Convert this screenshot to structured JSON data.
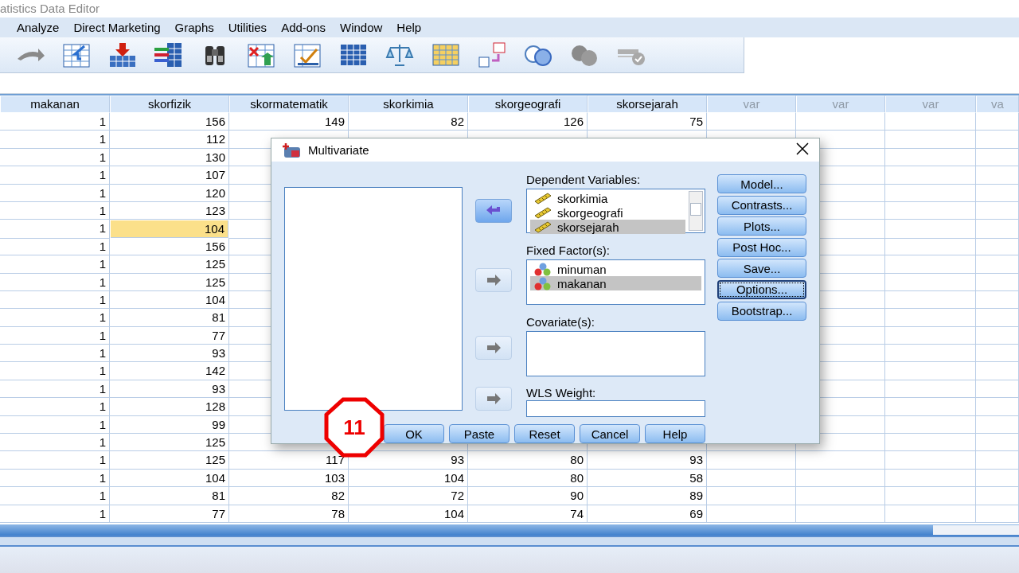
{
  "window": {
    "title": "atistics Data Editor"
  },
  "menu": [
    "Analyze",
    "Direct Marketing",
    "Graphs",
    "Utilities",
    "Add-ons",
    "Window",
    "Help"
  ],
  "grid": {
    "columns": [
      {
        "label": "makanan",
        "kind": "variable"
      },
      {
        "label": "skorfizik",
        "kind": "variable"
      },
      {
        "label": "skormatematik",
        "kind": "variable"
      },
      {
        "label": "skorkimia",
        "kind": "variable"
      },
      {
        "label": "skorgeografi",
        "kind": "variable"
      },
      {
        "label": "skorsejarah",
        "kind": "variable"
      },
      {
        "label": "var",
        "kind": "empty"
      },
      {
        "label": "var",
        "kind": "empty"
      },
      {
        "label": "var",
        "kind": "empty"
      },
      {
        "label": "va",
        "kind": "empty"
      }
    ],
    "rows": [
      {
        "cells": [
          {
            "text": "1",
            "selected": false
          },
          {
            "text": "156",
            "selected": false
          },
          {
            "text": "149",
            "selected": false
          },
          {
            "text": "82",
            "selected": false
          },
          {
            "text": "126",
            "selected": false
          },
          {
            "text": "75",
            "selected": false
          }
        ]
      },
      {
        "cells": [
          {
            "text": "1",
            "selected": false
          },
          {
            "text": "112",
            "selected": false
          }
        ]
      },
      {
        "cells": [
          {
            "text": "1",
            "selected": false
          },
          {
            "text": "130",
            "selected": false
          }
        ]
      },
      {
        "cells": [
          {
            "text": "1",
            "selected": false
          },
          {
            "text": "107",
            "selected": false
          }
        ]
      },
      {
        "cells": [
          {
            "text": "1",
            "selected": false
          },
          {
            "text": "120",
            "selected": false
          }
        ]
      },
      {
        "cells": [
          {
            "text": "1",
            "selected": false
          },
          {
            "text": "123",
            "selected": false
          }
        ]
      },
      {
        "cells": [
          {
            "text": "1",
            "selected": false
          },
          {
            "text": "104",
            "selected": true
          }
        ]
      },
      {
        "cells": [
          {
            "text": "1",
            "selected": false
          },
          {
            "text": "156",
            "selected": false
          }
        ]
      },
      {
        "cells": [
          {
            "text": "1",
            "selected": false
          },
          {
            "text": "125",
            "selected": false
          }
        ]
      },
      {
        "cells": [
          {
            "text": "1",
            "selected": false
          },
          {
            "text": "125",
            "selected": false
          }
        ]
      },
      {
        "cells": [
          {
            "text": "1",
            "selected": false
          },
          {
            "text": "104",
            "selected": false
          }
        ]
      },
      {
        "cells": [
          {
            "text": "1",
            "selected": false
          },
          {
            "text": "81",
            "selected": false
          }
        ]
      },
      {
        "cells": [
          {
            "text": "1",
            "selected": false
          },
          {
            "text": "77",
            "selected": false
          }
        ]
      },
      {
        "cells": [
          {
            "text": "1",
            "selected": false
          },
          {
            "text": "93",
            "selected": false
          }
        ]
      },
      {
        "cells": [
          {
            "text": "1",
            "selected": false
          },
          {
            "text": "142",
            "selected": false
          }
        ]
      },
      {
        "cells": [
          {
            "text": "1",
            "selected": false
          },
          {
            "text": "93",
            "selected": false
          }
        ]
      },
      {
        "cells": [
          {
            "text": "1",
            "selected": false
          },
          {
            "text": "128",
            "selected": false
          }
        ]
      },
      {
        "cells": [
          {
            "text": "1",
            "selected": false
          },
          {
            "text": "99",
            "selected": false
          }
        ]
      },
      {
        "cells": [
          {
            "text": "1",
            "selected": false
          },
          {
            "text": "125",
            "selected": false
          }
        ]
      },
      {
        "cells": [
          {
            "text": "1",
            "selected": false
          },
          {
            "text": "125",
            "selected": false
          },
          {
            "text": "117",
            "selected": false
          },
          {
            "text": "93",
            "selected": false
          },
          {
            "text": "80",
            "selected": false
          },
          {
            "text": "93",
            "selected": false
          }
        ]
      },
      {
        "cells": [
          {
            "text": "1",
            "selected": false
          },
          {
            "text": "104",
            "selected": false
          },
          {
            "text": "103",
            "selected": false
          },
          {
            "text": "104",
            "selected": false
          },
          {
            "text": "80",
            "selected": false
          },
          {
            "text": "58",
            "selected": false
          }
        ]
      },
      {
        "cells": [
          {
            "text": "1",
            "selected": false
          },
          {
            "text": "81",
            "selected": false
          },
          {
            "text": "82",
            "selected": false
          },
          {
            "text": "72",
            "selected": false
          },
          {
            "text": "90",
            "selected": false
          },
          {
            "text": "89",
            "selected": false
          }
        ]
      },
      {
        "cells": [
          {
            "text": "1",
            "selected": false
          },
          {
            "text": "77",
            "selected": false
          },
          {
            "text": "78",
            "selected": false
          },
          {
            "text": "104",
            "selected": false
          },
          {
            "text": "74",
            "selected": false
          },
          {
            "text": "69",
            "selected": false
          }
        ]
      }
    ]
  },
  "dialog": {
    "title": "Multivariate",
    "arrow_buttons": [
      {
        "disabled": false
      },
      {
        "disabled": true
      },
      {
        "disabled": true
      },
      {
        "disabled": true
      }
    ],
    "dependent_label": "Dependent Variables:",
    "dependent_items": [
      {
        "label": "skorkimia",
        "kind": "scale",
        "selected": false
      },
      {
        "label": "skorgeografi",
        "kind": "scale",
        "selected": false
      },
      {
        "label": "skorsejarah",
        "kind": "scale",
        "selected": true
      }
    ],
    "factor_label": "Fixed Factor(s):",
    "factor_items": [
      {
        "label": "minuman",
        "kind": "nominal",
        "selected": false
      },
      {
        "label": "makanan",
        "kind": "nominal",
        "selected": true
      }
    ],
    "covariate_label": "Covariate(s):",
    "wls_label": "WLS Weight:",
    "side_buttons": [
      {
        "label": "Model...",
        "focused": false
      },
      {
        "label": "Contrasts...",
        "focused": false
      },
      {
        "label": "Plots...",
        "focused": false
      },
      {
        "label": "Post Hoc...",
        "focused": false
      },
      {
        "label": "Save...",
        "focused": false
      },
      {
        "label": "Options...",
        "focused": true
      },
      {
        "label": "Bootstrap...",
        "focused": false
      }
    ],
    "bottom_buttons": [
      "OK",
      "Paste",
      "Reset",
      "Cancel",
      "Help"
    ]
  },
  "annotation": {
    "label": "11"
  }
}
